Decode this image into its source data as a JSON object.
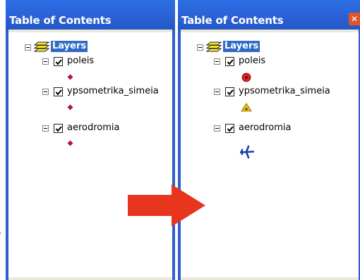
{
  "left_panel": {
    "title": "Table of Contents",
    "root_label": "Layers",
    "layers": [
      {
        "name": "poleis",
        "checked": true,
        "symbol": "small-diamond-marker"
      },
      {
        "name": "ypsometrika_simeia",
        "checked": true,
        "symbol": "small-diamond-marker"
      },
      {
        "name": "aerodromia",
        "checked": true,
        "symbol": "small-diamond-marker"
      }
    ]
  },
  "right_panel": {
    "title": "Table of Contents",
    "root_label": "Layers",
    "close_glyph": "✕",
    "layers": [
      {
        "name": "poleis",
        "checked": true,
        "symbol": "red-circle-marker"
      },
      {
        "name": "ypsometrika_simeia",
        "checked": true,
        "symbol": "yellow-triangle-marker"
      },
      {
        "name": "aerodromia",
        "checked": true,
        "symbol": "blue-airplane-marker"
      }
    ]
  },
  "colors": {
    "titlebar": "#2a62d6",
    "selection": "#316ac5",
    "arrow": "#e8351d",
    "marker_diamond": "#b01050",
    "marker_circle": "#e02020",
    "marker_triangle": "#f0c000",
    "marker_airplane": "#1a3ea8"
  }
}
